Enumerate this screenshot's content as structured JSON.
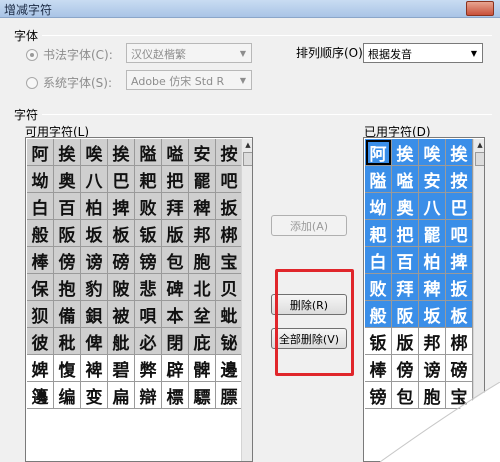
{
  "window": {
    "title": "增减字符"
  },
  "font_group": {
    "title": "字体",
    "calligraphy": {
      "label": "书法字体(C):",
      "selected": true,
      "value": "汉仪赵楷繁"
    },
    "system": {
      "label": "系统字体(S):",
      "selected": false,
      "value": "Adobe 仿宋 Std R"
    },
    "order_label": "排列顺序(O):",
    "order_value": "根据发音"
  },
  "chars_group": {
    "title": "字符",
    "available_label": "可用字符(L)",
    "used_label": "已用字符(D)",
    "available": [
      "阿",
      "挨",
      "唉",
      "挨",
      "隘",
      "嗌",
      "安",
      "按",
      "坳",
      "奥",
      "八",
      "巴",
      "耙",
      "把",
      "罷",
      "吧",
      "白",
      "百",
      "柏",
      "捭",
      "败",
      "拜",
      "稗",
      "扳",
      "般",
      "阪",
      "坂",
      "板",
      "钣",
      "版",
      "邦",
      "梆",
      "棒",
      "傍",
      "谤",
      "磅",
      "镑",
      "包",
      "胞",
      "宝",
      "保",
      "抱",
      "豹",
      "陂",
      "悲",
      "碑",
      "北",
      "贝",
      "狈",
      "備",
      "鋇",
      "被",
      "唄",
      "本",
      "坌",
      "蚍",
      "彼",
      "秕",
      "俾",
      "舭",
      "必",
      "閉",
      "庇",
      "铋",
      "婢",
      "愎",
      "裨",
      "碧",
      "弊",
      "辟",
      "髀",
      "邊",
      "籩",
      "编",
      "变",
      "扁",
      "辯",
      "標",
      "驃",
      "膘"
    ],
    "available_gray_count": 64,
    "used": [
      "阿",
      "挨",
      "唉",
      "挨",
      "隘",
      "嗌",
      "安",
      "按",
      "坳",
      "奥",
      "八",
      "巴",
      "耙",
      "把",
      "罷",
      "吧",
      "白",
      "百",
      "柏",
      "捭",
      "败",
      "拜",
      "稗",
      "扳",
      "般",
      "阪",
      "坂",
      "板",
      "钣",
      "版",
      "邦",
      "梆",
      "棒",
      "傍",
      "谤",
      "磅",
      "镑",
      "包",
      "胞",
      "宝"
    ],
    "used_blue_count": 28
  },
  "buttons": {
    "add": "添加(A)",
    "delete": "删除(R)",
    "delete_all": "全部删除(V)"
  },
  "colors": {
    "selected_cell": "#3a8ee8",
    "annotation": "#e0262b"
  }
}
